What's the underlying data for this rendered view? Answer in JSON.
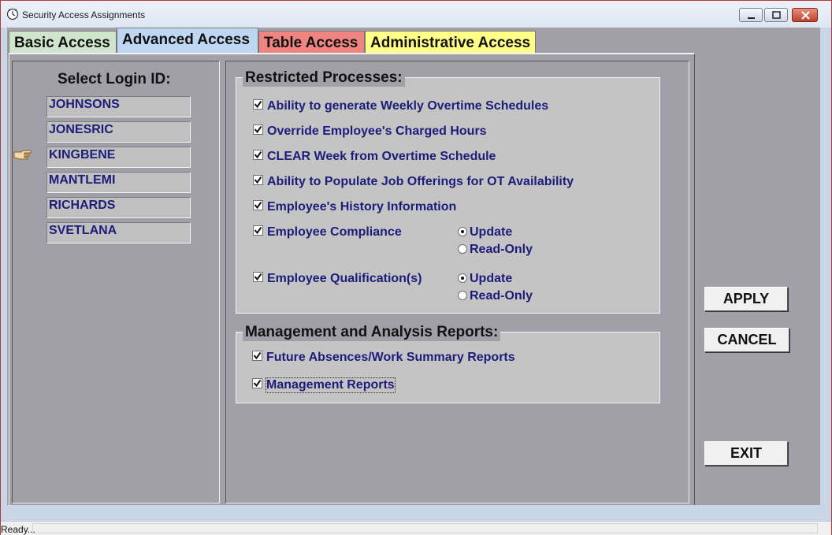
{
  "window": {
    "title": "Security Access Assignments",
    "icon": "clock-icon"
  },
  "tabs": [
    {
      "label": "Basic Access",
      "color": "#cfe6cd"
    },
    {
      "label": "Advanced Access",
      "color": "#bdd6f1",
      "selected": true
    },
    {
      "label": "Table Access",
      "color": "#f08480"
    },
    {
      "label": "Administrative Access",
      "color": "#ffff88"
    }
  ],
  "login": {
    "heading": "Select Login ID:",
    "selected_index": 2,
    "pointer_icon": "pointing-hand-icon",
    "ids": [
      "JOHNSONS",
      "JONESRIC",
      "KINGBENE",
      "MANTLEMI",
      "RICHARDS",
      "SVETLANA"
    ]
  },
  "restricted": {
    "title": "Restricted Processes:",
    "items": [
      {
        "label": "Ability to generate Weekly Overtime Schedules",
        "checked": true
      },
      {
        "label": "Override Employee's Charged Hours",
        "checked": true
      },
      {
        "label": "CLEAR Week from Overtime Schedule",
        "checked": true
      },
      {
        "label": "Ability to Populate Job Offerings for OT Availability",
        "checked": true
      },
      {
        "label": "Employee's History Information",
        "checked": true
      },
      {
        "label": "Employee Compliance",
        "checked": true,
        "mode": "Update"
      },
      {
        "label": "Employee Qualification(s)",
        "checked": true,
        "mode": "Update"
      }
    ],
    "radio_update": "Update",
    "radio_readonly": "Read-Only"
  },
  "reports": {
    "title": "Management and Analysis Reports:",
    "items": [
      {
        "label": "Future Absences/Work Summary Reports",
        "checked": true
      },
      {
        "label": "Management Reports",
        "checked": true,
        "focused": true
      }
    ]
  },
  "buttons": {
    "apply": "APPLY",
    "cancel": "CANCEL",
    "exit": "EXIT"
  },
  "status": {
    "text": "Ready..."
  },
  "colors": {
    "client_bg": "#a1a0a9",
    "label_text": "#1c1c7a"
  }
}
